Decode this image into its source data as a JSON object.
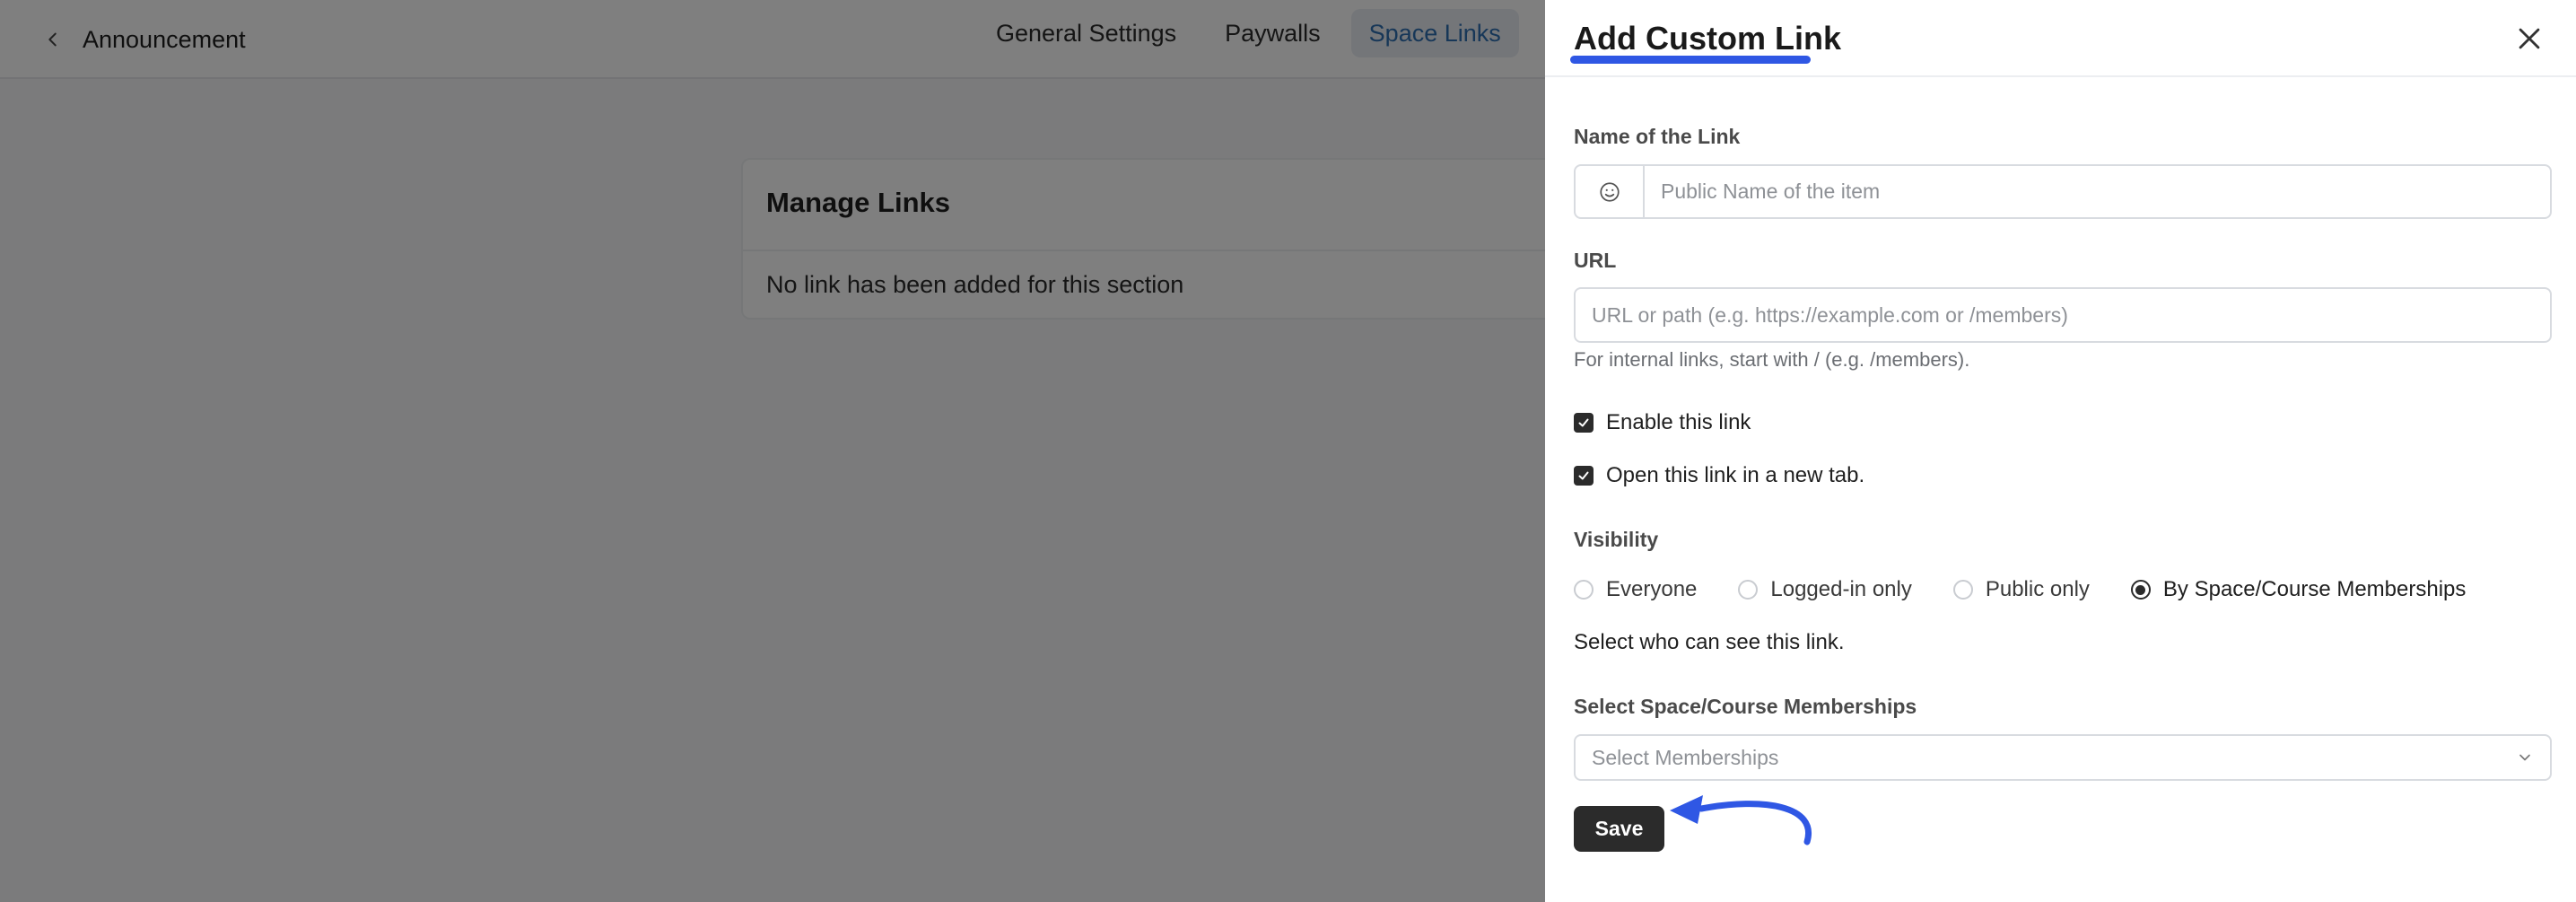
{
  "header": {
    "back_label": "Announcement",
    "tabs": [
      {
        "label": "General Settings",
        "active": false
      },
      {
        "label": "Paywalls",
        "active": false
      },
      {
        "label": "Space Links",
        "active": true
      }
    ]
  },
  "card": {
    "title": "Manage Links",
    "empty_message": "No link has been added for this section"
  },
  "drawer": {
    "title": "Add Custom Link",
    "name_label": "Name of the Link",
    "name_placeholder": "Public Name of the item",
    "name_value": "",
    "url_label": "URL",
    "url_placeholder": "URL or path (e.g. https://example.com or /members)",
    "url_value": "",
    "url_help": "For internal links, start with / (e.g. /members).",
    "checkboxes": [
      {
        "label": "Enable this link",
        "checked": true
      },
      {
        "label": "Open this link in a new tab.",
        "checked": true
      }
    ],
    "visibility_label": "Visibility",
    "visibility_options": [
      {
        "label": "Everyone",
        "selected": false
      },
      {
        "label": "Logged-in only",
        "selected": false
      },
      {
        "label": "Public only",
        "selected": false
      },
      {
        "label": "By Space/Course Memberships",
        "selected": true
      }
    ],
    "visibility_help": "Select who can see this link.",
    "memberships_label": "Select Space/Course Memberships",
    "memberships_placeholder": "Select Memberships",
    "save_label": "Save"
  },
  "icons": {
    "back": "chevron-left-icon",
    "close": "close-icon",
    "emoji": "smiley-icon",
    "check": "check-icon",
    "dropdown": "chevron-down-icon",
    "annotation": "curved-arrow-icon"
  },
  "colors": {
    "overlay": "rgba(0,0,0,0.5)",
    "accent_underline": "#2f57e4",
    "active_tab_text": "#2f6fb0",
    "primary_button": "#2b2b2b"
  }
}
